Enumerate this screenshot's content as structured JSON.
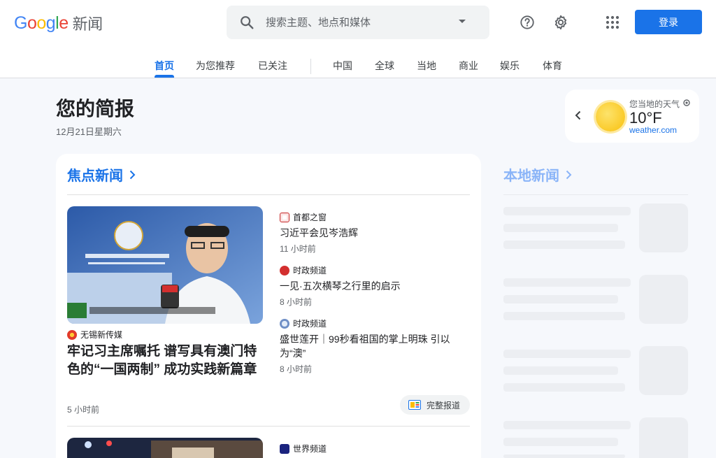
{
  "header": {
    "logo_letters": [
      "G",
      "o",
      "o",
      "g",
      "l",
      "e"
    ],
    "logo_suffix": "新闻",
    "search_placeholder": "搜索主题、地点和媒体",
    "login_label": "登录"
  },
  "tabs": [
    "首页",
    "为您推荐",
    "已关注",
    "中国",
    "全球",
    "当地",
    "商业",
    "娱乐",
    "体育"
  ],
  "active_tab": "首页",
  "briefing": {
    "title": "您的简报",
    "date": "12月21日星期六"
  },
  "weather": {
    "location_label": "您当地的天气",
    "temperature": "10°F",
    "source": "weather.com"
  },
  "focus": {
    "heading": "焦点新闻",
    "main_story": {
      "source": "无锡新传媒",
      "headline": "牢记习主席嘱托 谱写具有澳门特色的“一国两制” 成功实践新篇章",
      "time": "5 小时前"
    },
    "side_stories": [
      {
        "source": "首都之窗",
        "headline": "习近平会见岑浩辉",
        "time": "11 小时前"
      },
      {
        "source": "时政频道",
        "headline": "一见·五次横琴之行里的启示",
        "time": "8 小时前"
      },
      {
        "source": "时政频道",
        "headline": "盛世莲开｜99秒看祖国的掌上明珠 引以为“澳”",
        "time": "8 小时前"
      }
    ],
    "full_coverage_label": "完整报道",
    "next_source": "世界频道"
  },
  "local": {
    "heading": "本地新闻"
  },
  "colors": {
    "accent": "#1a73e8",
    "background": "#f6f8fc"
  },
  "icons": [
    "search-icon",
    "chevron-down-icon",
    "help-icon",
    "gear-icon",
    "apps-grid-icon",
    "chevron-left-icon",
    "location-icon",
    "chevron-right-icon",
    "full-coverage-icon"
  ]
}
